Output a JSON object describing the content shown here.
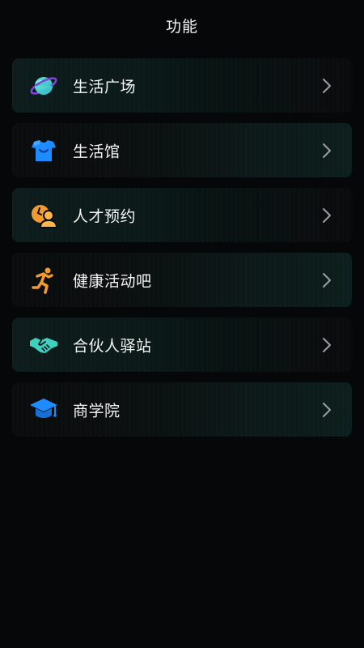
{
  "header": {
    "title": "功能"
  },
  "menu": {
    "items": [
      {
        "label": "生活广场",
        "icon": "planet-icon"
      },
      {
        "label": "生活馆",
        "icon": "shopping-bag-icon"
      },
      {
        "label": "人才预约",
        "icon": "talent-person-icon"
      },
      {
        "label": "健康活动吧",
        "icon": "running-person-icon"
      },
      {
        "label": "合伙人驿站",
        "icon": "handshake-icon"
      },
      {
        "label": "商学院",
        "icon": "graduation-cap-icon"
      }
    ]
  },
  "colors": {
    "background": "#050709",
    "text": "#f5f5f5",
    "arrow": "#9a9ea2",
    "teal": "#3fd0c0",
    "blue": "#1e8cff",
    "orange": "#f29a2e"
  }
}
